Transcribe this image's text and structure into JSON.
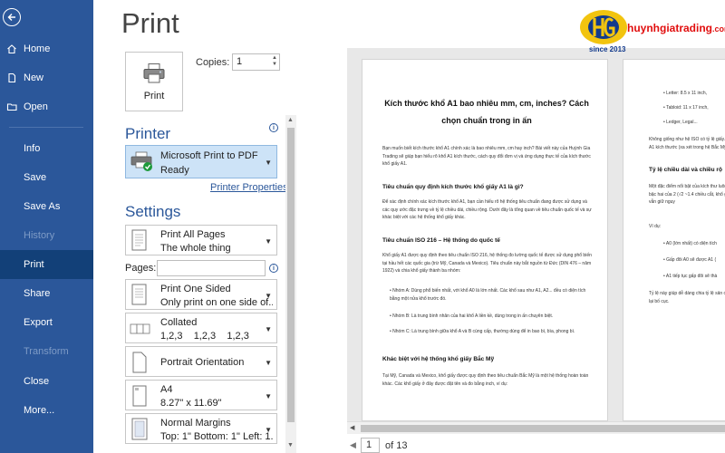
{
  "sidebar": {
    "items": [
      {
        "label": "Home",
        "icon": "home-icon"
      },
      {
        "label": "New",
        "icon": "new-document-icon"
      },
      {
        "label": "Open",
        "icon": "folder-open-icon"
      },
      {
        "label": "Info"
      },
      {
        "label": "Save"
      },
      {
        "label": "Save As"
      },
      {
        "label": "History"
      },
      {
        "label": "Print"
      },
      {
        "label": "Share"
      },
      {
        "label": "Export"
      },
      {
        "label": "Transform"
      },
      {
        "label": "Close"
      },
      {
        "label": "More..."
      }
    ],
    "active": "Print",
    "disabled": [
      "History",
      "Transform"
    ],
    "color": "#2b579a"
  },
  "page_title": "Print",
  "print_button": {
    "label": "Print"
  },
  "copies": {
    "label": "Copies:",
    "value": "1"
  },
  "printer": {
    "section_title": "Printer",
    "name": "Microsoft Print to PDF",
    "status": "Ready",
    "properties_link": "Printer Properties"
  },
  "settings": {
    "section_title": "Settings",
    "pages_label": "Pages:",
    "items": [
      {
        "line1": "Print All Pages",
        "line2": "The whole thing"
      },
      {
        "line1": "Print One Sided",
        "line2": "Only print on one side of..."
      },
      {
        "line1": "Collated",
        "line2": "1,2,3    1,2,3    1,2,3"
      },
      {
        "line1": "Portrait Orientation",
        "line2": ""
      },
      {
        "line1": "A4",
        "line2": "8.27\" x 11.69\""
      },
      {
        "line1": "Normal Margins",
        "line2": "Top: 1\" Bottom: 1\" Left: 1..."
      }
    ]
  },
  "preview": {
    "page1": {
      "title": "Kích thước khổ A1 bao nhiêu mm, cm, inches? Cách chọn chuẩn trong in ấn",
      "intro": "Bạn muốn biết kích thước khổ A1 chính xác là bao nhiêu mm, cm hay inch? Bài viết này của Huỳnh Gia Trading sẽ giúp bạn hiểu rõ khổ A1 kích thước, cách quy đổi đơn vị và ứng dụng thực tế của kích thước khổ giấy A1.",
      "h1": "Tiêu chuẩn quy định kích thước khổ giấy A1 là gì?",
      "p1": "Để xác định chính xác kích thước khổ A1, bạn cần hiểu rõ hệ thống tiêu chuẩn đang được sử dụng và các quy ước đặc trưng về tỷ lệ chiều dài, chiều rộng. Dưới đây là tổng quan về tiêu chuẩn quốc tế và sự khác biệt với các hệ thống khổ giấy khác.",
      "h2": "Tiêu chuẩn ISO 216 – Hệ thống do quốc tế",
      "p2": "Khổ giấy A1 được quy định theo tiêu chuẩn ISO 216, hệ thống đo lường quốc tế được sử dụng phổ biến tại hầu hết các quốc gia (trừ Mỹ, Canada và Mexico). Tiêu chuẩn này bắt nguồn từ Đức (DIN 476 – năm 1922) và chia khổ giấy thành ba nhóm:",
      "bullets": [
        "Nhóm A: Dùng phổ biến nhất, với khổ A0 là lớn nhất. Các khổ sau như A1, A2... đều có diện tích bằng một nửa khổ trước đó.",
        "Nhóm B: Là trung bình nhân của hai khổ A liền kề, dùng trong in ấn chuyên biệt.",
        "Nhóm C: Là trung bình giữa khổ A và B cùng cấp, thường dùng để in bao bì, bìa, phong bì."
      ],
      "h3": "Khác biệt với hệ thống khổ giấy Bắc Mỹ",
      "p3": "Tại Mỹ, Canada và Mexico, khổ giấy được quy định theo tiêu chuẩn Bắc Mỹ là một hệ thống hoàn toàn khác. Các khổ giấy ở đây được đặt tên và đo bằng inch, ví dụ:"
    },
    "page2": {
      "list": [
        "Letter: 8.5 x 11 inch,",
        "Tabloid: 11 x 17 inch,",
        "Ledger, Legal..."
      ],
      "p1": "Không giống như hệ ISO có tỷ lệ giấy. Vì vậy, khổ A1 kích thước (xa xét trong hệ Bắc Mỹ.",
      "h1": "Tỷ lệ chiều dài và chiều rộ",
      "p2": "Một đặc điểm nổi bật của kích thư luôn bằng căn bậc hai của 2 (√2 ~1.4 chiều cắt, khổ giấy sau vẫn giữ nguy",
      "p2b": "Ví dụ:",
      "list2": [
        "A0 (lớn nhất) có diện tích",
        "Gấp đôi A0 sẽ được A1 (",
        "A1 tiếp tục gấp đôi sẽ thà"
      ],
      "p3": "Tỷ lệ này giúp dễ dàng chia tỷ lệ sản căn chỉnh lại bố cục."
    }
  },
  "page_nav": {
    "current": "1",
    "of_text": "of 13"
  },
  "logo": {
    "text": "huynhgiatrading",
    "suffix": ".com",
    "since": "since 2013"
  }
}
